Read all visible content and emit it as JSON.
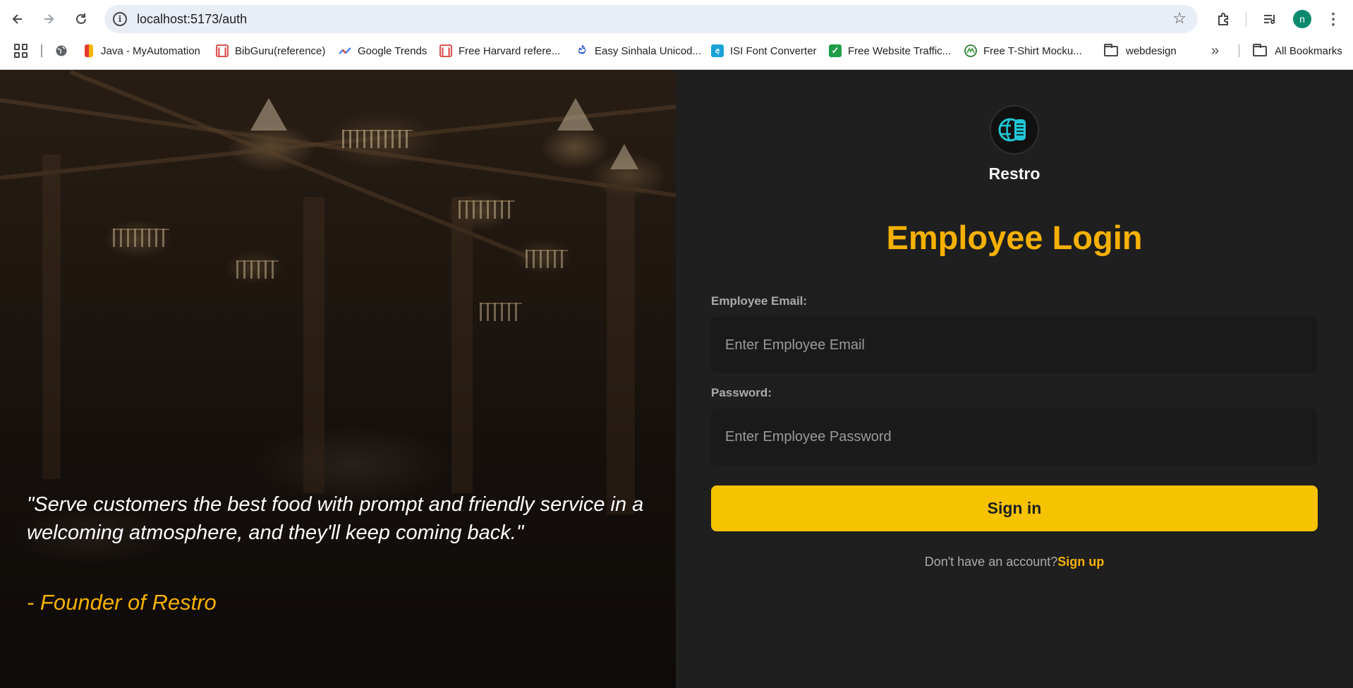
{
  "browser": {
    "url": "localhost:5173/auth",
    "avatar_letter": "n",
    "bookmarks": [
      {
        "label": "Java - MyAutomation",
        "icon": "bookmark-java-icon"
      },
      {
        "label": "BibGuru(reference)",
        "icon": "bookmark-book-icon"
      },
      {
        "label": "Google Trends",
        "icon": "bookmark-trends-icon"
      },
      {
        "label": "Free Harvard refere...",
        "icon": "bookmark-book-icon"
      },
      {
        "label": "Easy Sinhala Unicod...",
        "icon": "bookmark-sinhala-icon"
      },
      {
        "label": "ISI Font Converter",
        "icon": "bookmark-font-icon"
      },
      {
        "label": "Free Website Traffic...",
        "icon": "bookmark-check-icon"
      },
      {
        "label": "Free T-Shirt Mocku...",
        "icon": "bookmark-mockup-icon"
      },
      {
        "label": "webdesign",
        "icon": "folder-icon"
      }
    ],
    "all_bookmarks": "All Bookmarks",
    "overflow": "»"
  },
  "hero": {
    "quote": "\"Serve customers the best food with prompt and friendly service in a welcoming atmosphere, and they'll keep coming back.\"",
    "author": "- Founder of Restro"
  },
  "auth": {
    "brand": "Restro",
    "title": "Employee Login",
    "email_label": "Employee Email:",
    "email_placeholder": "Enter Employee Email",
    "password_label": "Password:",
    "password_placeholder": "Enter Employee Password",
    "submit_label": "Sign in",
    "switch_prompt": "Don't have an account?",
    "switch_link": "Sign up"
  },
  "colors": {
    "accent": "#f6b100",
    "button": "#f6c300",
    "panel_bg": "#1f1f1f",
    "input_bg": "#1a1a1a"
  }
}
